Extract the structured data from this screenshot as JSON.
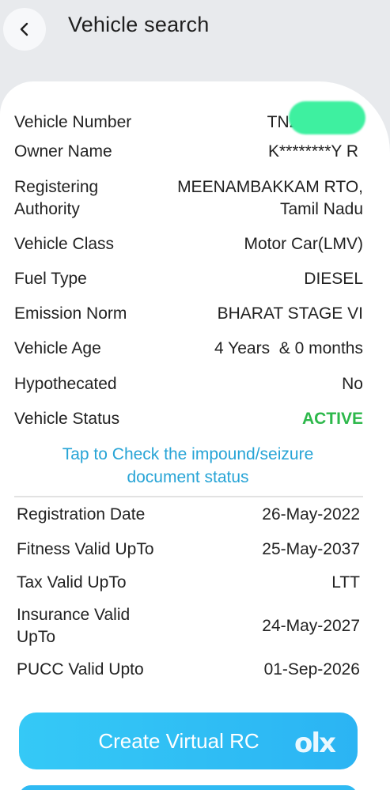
{
  "header": {
    "title": "Vehicle search",
    "back_icon": "chevron-left-icon"
  },
  "vehicle": {
    "rows": [
      {
        "label": "Vehicle Number",
        "value": "TN22"
      },
      {
        "label": "Owner Name",
        "value": "K********Y R"
      },
      {
        "label": "Registering Authority",
        "label_lines": [
          "Registering",
          "Authority"
        ],
        "value_lines": [
          "MEENAMBAKKAM RTO,",
          "Tamil Nadu"
        ]
      },
      {
        "label": "Vehicle Class",
        "value": "Motor Car(LMV)"
      },
      {
        "label": "Fuel Type",
        "value": "DIESEL"
      },
      {
        "label": "Emission Norm",
        "value": "BHARAT STAGE VI"
      },
      {
        "label": "Vehicle Age",
        "value": "4 Years  & 0 months"
      },
      {
        "label": "Hypothecated",
        "value": "No"
      },
      {
        "label": "Vehicle Status",
        "value": "ACTIVE"
      }
    ]
  },
  "impound_link": {
    "line1": "Tap to Check the impound/seizure",
    "line2": "document status"
  },
  "validity": {
    "rows": [
      {
        "label": "Registration Date",
        "value": "26-May-2022"
      },
      {
        "label": "Fitness Valid UpTo",
        "value": "25-May-2037"
      },
      {
        "label": "Tax Valid UpTo",
        "value": "LTT"
      },
      {
        "label_lines": [
          "Insurance Valid",
          "UpTo"
        ],
        "value": "24-May-2027"
      },
      {
        "label": "PUCC Valid Upto",
        "value": "01-Sep-2026"
      }
    ]
  },
  "cta": {
    "label": "Create Virtual RC"
  },
  "watermark": "olx",
  "colors": {
    "status_active": "#2db84b",
    "link": "#27a4d6",
    "cta": "#2bb4f3",
    "redaction": "#3ef0a0"
  }
}
